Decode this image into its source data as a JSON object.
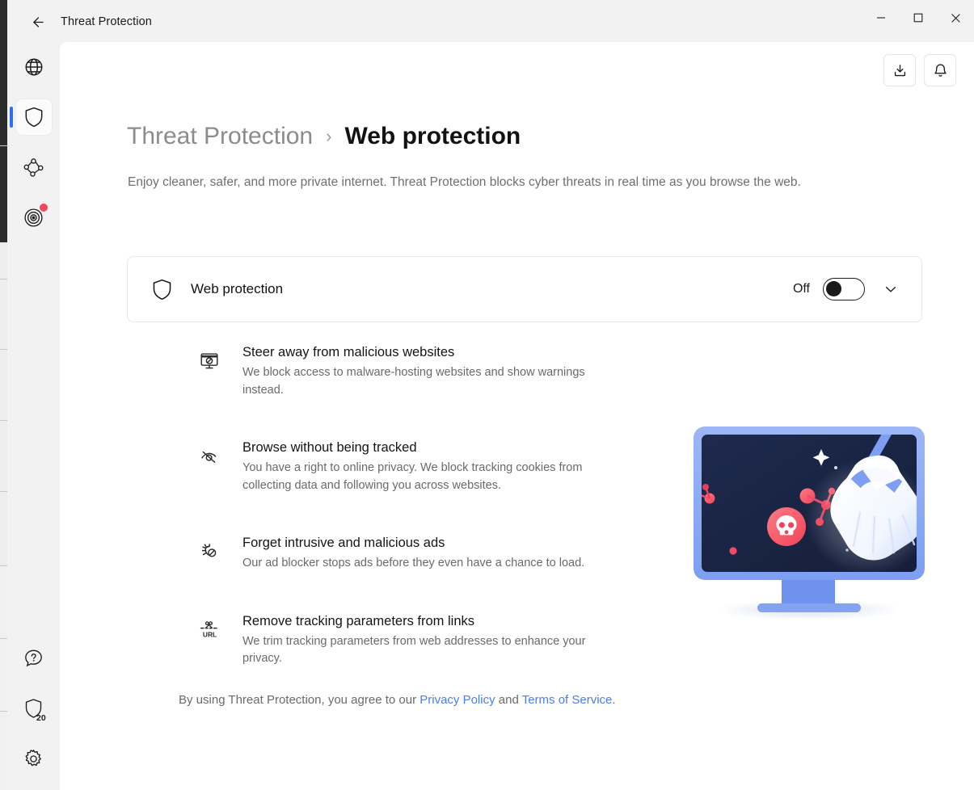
{
  "window": {
    "title": "Threat Protection",
    "back_icon": "arrow-left-icon",
    "minimize_label": "Minimize",
    "maximize_label": "Maximize",
    "close_label": "Close"
  },
  "sidebar": {
    "top_items": [
      {
        "id": "vpn",
        "icon": "globe-icon",
        "label": "VPN",
        "active": false,
        "badge": false
      },
      {
        "id": "threat-protection",
        "icon": "shield-icon",
        "label": "Threat Protection",
        "active": true,
        "badge": false
      },
      {
        "id": "meshnet",
        "icon": "meshnet-icon",
        "label": "Meshnet",
        "active": false,
        "badge": false
      },
      {
        "id": "dark-web-monitor",
        "icon": "radar-icon",
        "label": "Dark Web Monitor",
        "active": false,
        "badge": true
      }
    ],
    "bottom_items": [
      {
        "id": "help",
        "icon": "help-icon",
        "label": "Help",
        "count": ""
      },
      {
        "id": "security-score",
        "icon": "shield-count-icon",
        "label": "Security score",
        "count": "20"
      },
      {
        "id": "settings",
        "icon": "gear-icon",
        "label": "Settings",
        "count": ""
      }
    ]
  },
  "toolbar": {
    "download_icon": "download-icon",
    "download_label": "Downloads",
    "bell_icon": "bell-icon",
    "bell_label": "Notifications"
  },
  "header": {
    "breadcrumb_parent": "Threat Protection",
    "breadcrumb_separator": "›",
    "breadcrumb_current": "Web protection",
    "subtitle": "Enjoy cleaner, safer, and more private internet. Threat Protection blocks cyber threats in real time as you browse the web."
  },
  "web_protection_card": {
    "icon": "shield-icon",
    "label": "Web protection",
    "state_label": "Off",
    "enabled": false,
    "expand_icon": "chevron-down-icon"
  },
  "features": [
    {
      "icon": "monitor-blocked-icon",
      "title": "Steer away from malicious websites",
      "desc": "We block access to malware-hosting websites and show warnings instead."
    },
    {
      "icon": "eye-off-icon",
      "title": "Browse without being tracked",
      "desc": "You have a right to online privacy. We block tracking cookies from collecting data and following you across websites."
    },
    {
      "icon": "bug-blocked-icon",
      "title": "Forget intrusive and malicious ads",
      "desc": "Our ad blocker stops ads before they even have a chance to load."
    },
    {
      "icon": "scissors-url-icon",
      "title": "Remove tracking parameters from links",
      "desc": "We trim tracking parameters from web addresses to enhance your privacy."
    }
  ],
  "legal": {
    "prefix": "By using Threat Protection, you agree to our ",
    "privacy_link": "Privacy Policy",
    "middle": " and ",
    "terms_link": "Terms of Service",
    "suffix": "."
  },
  "illustration": {
    "name": "monitor-broom-malware-illustration",
    "url_label": "URL"
  },
  "colors": {
    "accent_blue": "#2f6fed",
    "link_blue": "#4a7fe8",
    "badge_red": "#f5475c",
    "chrome_gray": "#f2f2f2",
    "screen_navy": "#1b2745"
  }
}
